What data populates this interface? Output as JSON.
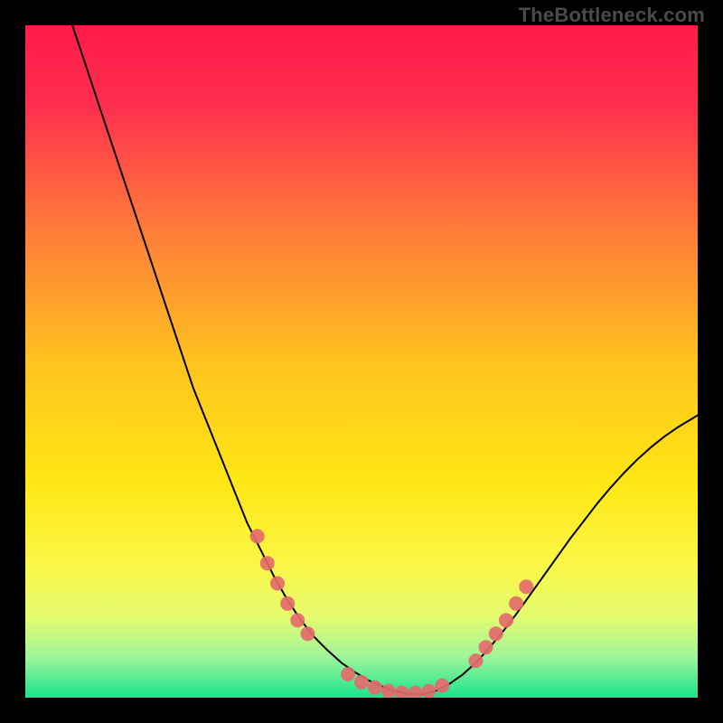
{
  "watermark": "TheBottleneck.com",
  "chart_data": {
    "type": "line",
    "title": "",
    "xlabel": "",
    "ylabel": "",
    "xlim": [
      0,
      100
    ],
    "ylim": [
      0,
      100
    ],
    "background_gradient_stops": [
      {
        "offset": 0.0,
        "color": "#ff1a4a"
      },
      {
        "offset": 0.12,
        "color": "#ff2f4e"
      },
      {
        "offset": 0.3,
        "color": "#ff7a3a"
      },
      {
        "offset": 0.5,
        "color": "#ffc21f"
      },
      {
        "offset": 0.68,
        "color": "#ffe714"
      },
      {
        "offset": 0.8,
        "color": "#fbf646"
      },
      {
        "offset": 0.88,
        "color": "#e4fb6f"
      },
      {
        "offset": 0.94,
        "color": "#9ef59a"
      },
      {
        "offset": 1.0,
        "color": "#17e38c"
      }
    ],
    "series": [
      {
        "name": "curve",
        "type": "line",
        "stroke": "#000000",
        "width": 2,
        "x": [
          7,
          9,
          11,
          13,
          15,
          17,
          19,
          21,
          23,
          25,
          27,
          29,
          31,
          33,
          35,
          37,
          39,
          41,
          43,
          45,
          47,
          49,
          51,
          53,
          55,
          57,
          59,
          61,
          63,
          65,
          67,
          69,
          71,
          73,
          75,
          77,
          79,
          81,
          83,
          85,
          87,
          89,
          91,
          93,
          95,
          97,
          99,
          100
        ],
        "y": [
          100,
          94,
          88,
          82,
          76,
          70,
          64,
          58,
          52,
          46,
          41,
          36,
          31,
          26,
          22,
          18,
          14.5,
          11.5,
          9,
          7,
          5.2,
          3.8,
          2.6,
          1.7,
          1.0,
          0.5,
          0.5,
          1.0,
          2.0,
          3.4,
          5.2,
          7.4,
          9.8,
          12.4,
          15.2,
          18,
          20.8,
          23.6,
          26.2,
          28.8,
          31.2,
          33.4,
          35.4,
          37.2,
          38.8,
          40.2,
          41.4,
          42.0
        ]
      },
      {
        "name": "left-markers",
        "type": "scatter",
        "color": "#e46a6d",
        "radius": 8,
        "x": [
          34.5,
          36,
          37.5,
          39,
          40.5,
          42
        ],
        "y": [
          24,
          20,
          17,
          14,
          11.5,
          9.5
        ]
      },
      {
        "name": "right-markers",
        "type": "scatter",
        "color": "#e46a6d",
        "radius": 8,
        "x": [
          67,
          68.5,
          70,
          71.5,
          73,
          74.5
        ],
        "y": [
          5.5,
          7.5,
          9.5,
          11.5,
          14,
          16.5
        ]
      },
      {
        "name": "bottom-markers",
        "type": "scatter",
        "color": "#e46a6d",
        "radius": 8,
        "x": [
          48,
          50,
          52,
          54,
          56,
          58,
          60,
          62
        ],
        "y": [
          3.5,
          2.3,
          1.5,
          1.0,
          0.7,
          0.7,
          1.0,
          1.8
        ]
      }
    ]
  }
}
